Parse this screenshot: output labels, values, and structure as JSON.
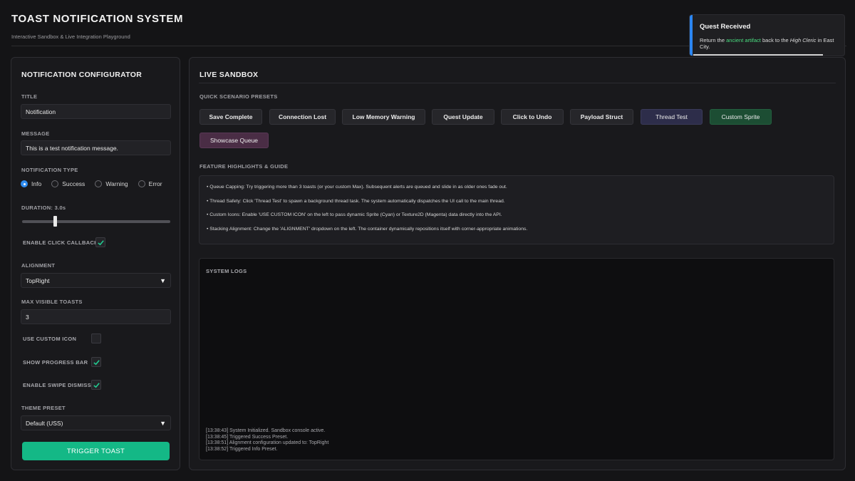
{
  "header": {
    "title": "TOAST NOTIFICATION SYSTEM",
    "subtitle": "Interactive Sandbox & Live Integration Playground"
  },
  "configurator": {
    "title": "NOTIFICATION CONFIGURATOR",
    "title_label": "TITLE",
    "title_value": "Notification",
    "message_label": "MESSAGE",
    "message_value": "This is a test notification message.",
    "type_label": "NOTIFICATION TYPE",
    "types": [
      {
        "label": "Info",
        "selected": true
      },
      {
        "label": "Success",
        "selected": false
      },
      {
        "label": "Warning",
        "selected": false
      },
      {
        "label": "Error",
        "selected": false
      }
    ],
    "duration_label": "DURATION: 3.0s",
    "duration_fraction": 0.22,
    "click_callback_label": "ENABLE CLICK CALLBACK",
    "click_callback_checked": true,
    "alignment_label": "ALIGNMENT",
    "alignment_value": "TopRight",
    "max_visible_label": "MAX VISIBLE TOASTS",
    "max_visible_value": "3",
    "custom_icon_label": "USE CUSTOM ICON",
    "custom_icon_checked": false,
    "progress_bar_label": "SHOW PROGRESS BAR",
    "progress_bar_checked": true,
    "swipe_dismiss_label": "ENABLE SWIPE DISMISS",
    "swipe_dismiss_checked": true,
    "theme_label": "THEME PRESET",
    "theme_value": "Default (USS)",
    "trigger_label": "TRIGGER TOAST",
    "caret": "▼"
  },
  "sandbox": {
    "title": "LIVE SANDBOX",
    "presets_label": "QUICK SCENARIO PRESETS",
    "presets": [
      "Save Complete",
      "Connection Lost",
      "Low Memory Warning",
      "Quest Update",
      "Click to Undo",
      "Payload Struct",
      "Thread Test",
      "Custom Sprite",
      "Showcase Queue"
    ],
    "guide_label": "FEATURE HIGHLIGHTS & GUIDE",
    "guide_items": [
      "• Queue Capping: Try triggering more than 3 toasts (or your custom Max). Subsequent alerts are queued and slide in as older ones fade out.",
      "• Thread Safety: Click 'Thread Test' to spawn a background thread task. The system automatically dispatches the UI call to the main thread.",
      "• Custom Icons: Enable 'USE CUSTOM ICON' on the left to pass dynamic Sprite (Cyan) or Texture2D (Magenta) data directly into the API.",
      "• Stacking Alignment: Change the 'ALIGNMENT' dropdown on the left. The container dynamically repositions itself with corner-appropriate animations."
    ],
    "logs_title": "SYSTEM LOGS",
    "logs": [
      "[13:38:43] System Initialized. Sandbox console active.",
      "[13:38:45] Triggered Success Preset.",
      "[13:38:51] Alignment configuration updated to: TopRight",
      "[13:38:52] Triggered Info Preset."
    ]
  },
  "toast": {
    "title": "Quest Received",
    "msg_part1": "Return the ",
    "msg_highlight": "ancient artifact",
    "msg_part2": " back to the ",
    "msg_italic": "High Cleric",
    "msg_part3": " in East City.",
    "accent_color": "#2b86f2",
    "progress_fraction": 0.85
  }
}
